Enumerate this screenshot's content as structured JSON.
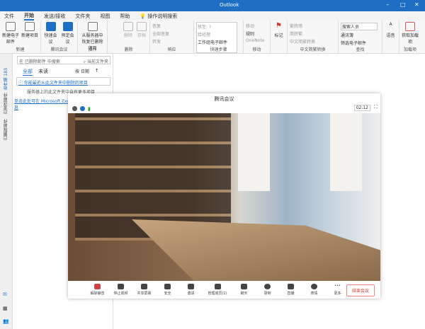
{
  "app": {
    "title": "Outlook"
  },
  "tabs": [
    "文件",
    "开始",
    "发送/接收",
    "文件夹",
    "视图",
    "帮助",
    "操作说明搜索"
  ],
  "ribbon": {
    "new": {
      "label": "新建",
      "buttons": [
        "新建电子邮件",
        "新建项目"
      ]
    },
    "tencent": {
      "label": "腾讯会议",
      "buttons": [
        "快速会议",
        "预定会议"
      ]
    },
    "action": {
      "label": "操作",
      "buttons": [
        "从服务器中恢复已删除项目"
      ]
    },
    "delete": {
      "label": "删除",
      "buttons": [
        "删除",
        "存档"
      ]
    },
    "respond": {
      "label": "响应",
      "buttons": [
        "答复",
        "全部答复",
        "转发"
      ]
    },
    "quicksteps": {
      "label": "快速步骤",
      "items": [
        "移至: ?",
        "给经理",
        "工作组电子邮件"
      ]
    },
    "move": {
      "label": "移动",
      "items": [
        "移动",
        "规则",
        "OneNote"
      ]
    },
    "tags": {
      "label": "",
      "buttons": [
        "标记"
      ]
    },
    "convert": {
      "label": "中文简繁转换",
      "items": [
        "繁转简",
        "简转繁",
        "中文简繁转换"
      ]
    },
    "find": {
      "label": "查找",
      "search_placeholder": "搜索人员",
      "items": [
        "通讯簿",
        "筛选电子邮件"
      ]
    },
    "voice": {
      "buttons": [
        "语音"
      ]
    },
    "addins": {
      "label": "加载项",
      "buttons": [
        "获取加载项"
      ]
    }
  },
  "nav": {
    "folders": [
      "收件箱 183",
      "已发送邮件",
      "已删除邮件"
    ]
  },
  "folder": {
    "search_placeholder": "在 已删除邮件 中搜索",
    "scope": "当前文件夹",
    "filters": [
      "全部",
      "未读"
    ],
    "sort": "按 日期",
    "info": "你能最近从此文件夹中删除的项目",
    "more": "服务器上的此文件夹中自有更多项目",
    "link": "单击此处可在 Microsoft Exchange 上查看更多信息"
  },
  "meeting": {
    "title": "腾讯会议",
    "timer": "02:12",
    "toolbar": [
      "解除静音",
      "停止视频",
      "共享屏幕",
      "安全",
      "邀请",
      "管理成员(1)",
      "聊天",
      "录制",
      "直播",
      "表情",
      "更多"
    ],
    "end": "结束会议"
  }
}
